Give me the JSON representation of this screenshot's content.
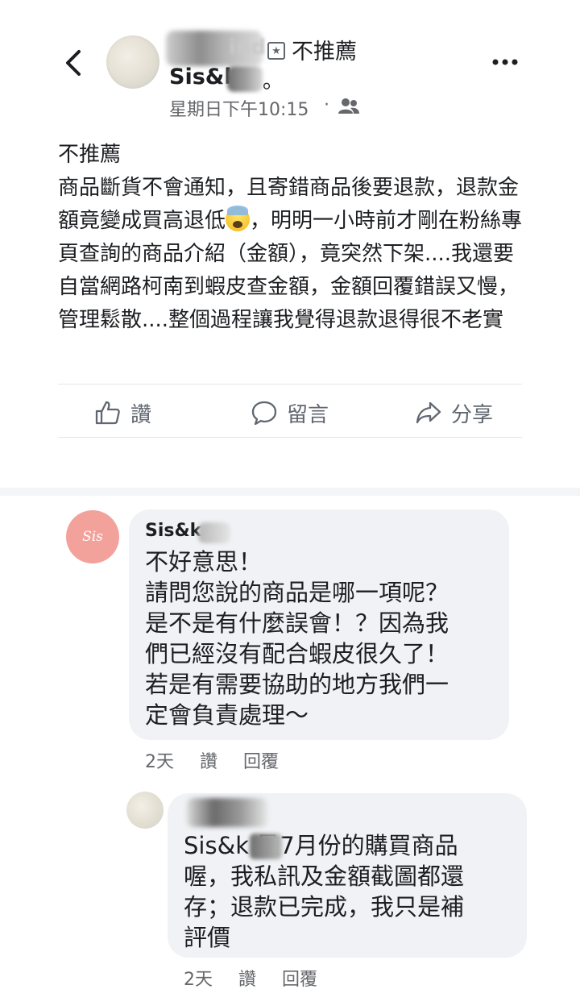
{
  "post": {
    "review_label": "不推薦",
    "page_name_visible": "Sis&k",
    "page_name_suffix": "。",
    "author_name_visible": "ind",
    "timestamp": "星期日下午10:15",
    "separator": "·",
    "audience_icon": "friends-icon",
    "more_icon": "more-icon",
    "back_icon": "chevron-left-icon",
    "text_line1": "不推薦",
    "text_para_a": "商品斷貨不會通知，且寄錯商品後要退款，退款金額竟變成買高退低",
    "text_para_b": "，明明一小時前才剛在粉絲專頁查詢的商品介紹（金額），竟突然下架....我還要自當網路柯南到蝦皮查金額，金額回覆錯誤又慢，管理鬆散....整個過程讓我覺得退款退得很不老實"
  },
  "actions": {
    "like_label": "讚",
    "comment_label": "留言",
    "share_label": "分享"
  },
  "comments": [
    {
      "author_visible": "Sis&k",
      "avatar_text": "Sis",
      "text": "不好意思！\n請問您說的商品是哪一項呢？\n是不是有什麼誤會！？因為我\n們已經沒有配合蝦皮很久了！\n若是有需要協助的地方我們一\n定會負責處理～",
      "time": "2天",
      "like_label": "讚",
      "reply_label": "回覆"
    },
    {
      "text": "Sis&k      是7月份的購買商品\n喔，我私訊及金額截圖都還\n存；退款已完成，我只是補\n評價",
      "time": "2天",
      "like_label": "讚",
      "reply_label": "回覆"
    }
  ],
  "colors": {
    "text": "#1c1e21",
    "secondary": "#65676b",
    "bubble": "#f0f2f5",
    "brand_avatar": "#f2a29b"
  }
}
